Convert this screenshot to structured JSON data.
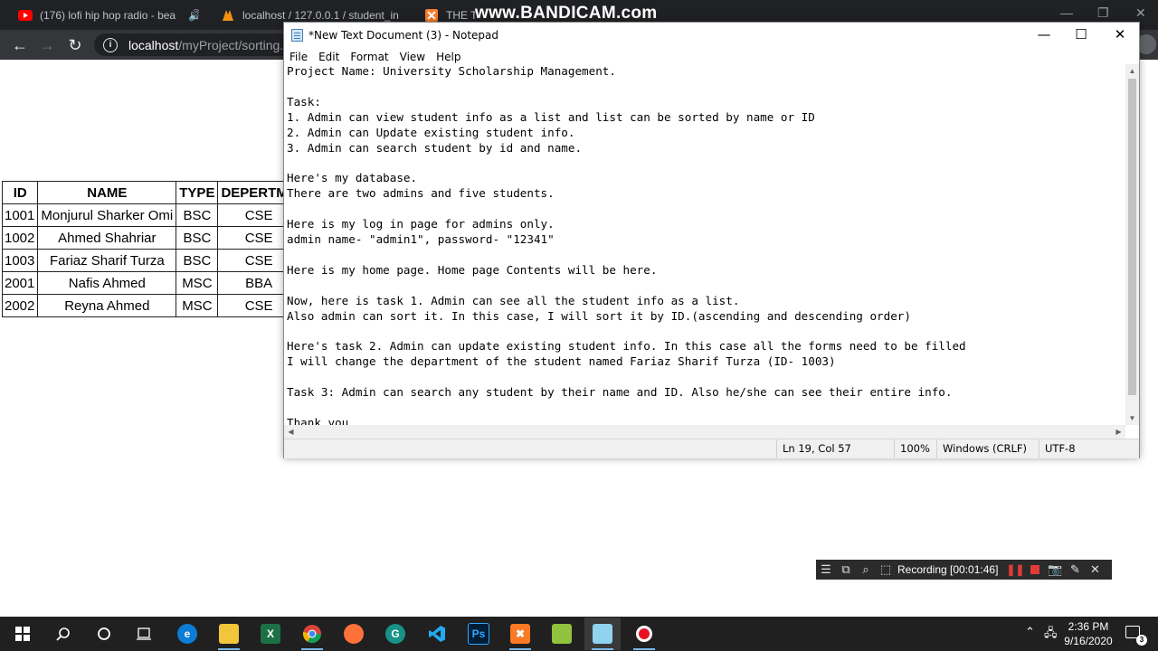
{
  "browser": {
    "tabs": [
      {
        "title": "(176) lofi hip hop radio - bea",
        "icon": "youtube-icon",
        "icon_color": "#ff0000"
      },
      {
        "title": "localhost / 127.0.0.1 / student_in",
        "icon": "phpmyadmin-icon",
        "icon_color": "#f29111"
      },
      {
        "title": "THE T",
        "icon": "xampp-icon",
        "icon_color": "#fb7a24"
      }
    ],
    "url_host": "localhost",
    "url_path": "/myProject/sorting.ph",
    "watermark": "www.BANDICAM.com"
  },
  "page": {
    "table": {
      "headers": [
        "ID",
        "NAME",
        "TYPE",
        "DEPERTME"
      ],
      "rows": [
        [
          "1001",
          "Monjurul Sharker Omi",
          "BSC",
          "CSE"
        ],
        [
          "1002",
          "Ahmed Shahriar",
          "BSC",
          "CSE"
        ],
        [
          "1003",
          "Fariaz Sharif Turza",
          "BSC",
          "CSE"
        ],
        [
          "2001",
          "Nafis Ahmed",
          "MSC",
          "BBA"
        ],
        [
          "2002",
          "Reyna Ahmed",
          "MSC",
          "CSE"
        ]
      ]
    }
  },
  "notepad": {
    "title": "*New Text Document (3) - Notepad",
    "menu": [
      "File",
      "Edit",
      "Format",
      "View",
      "Help"
    ],
    "content": "Project Name: University Scholarship Management.\n\nTask:\n1. Admin can view student info as a list and list can be sorted by name or ID\n2. Admin can Update existing student info.\n3. Admin can search student by id and name.\n\nHere's my database.\nThere are two admins and five students.\n\nHere is my log in page for admins only.\nadmin name- \"admin1\", password- \"12341\"\n\nHere is my home page. Home page Contents will be here.\n\nNow, here is task 1. Admin can see all the student info as a list.\nAlso admin can sort it. In this case, I will sort it by ID.(ascending and descending order)\n\nHere's task 2. Admin can update existing student info. In this case all the forms need to be filled\nI will change the department of the student named Fariaz Sharif Turza (ID- 1003)\n\nTask 3: Admin can search any student by their name and ID. Also he/she can see their entire info.\n\nThank you",
    "status": {
      "position": "Ln 19, Col 57",
      "zoom": "100%",
      "line_ending": "Windows (CRLF)",
      "encoding": "UTF-8"
    }
  },
  "recorder": {
    "status": "Recording [00:01:46]"
  },
  "taskbar": {
    "time": "2:36 PM",
    "date": "9/16/2020",
    "notification_count": "3"
  }
}
